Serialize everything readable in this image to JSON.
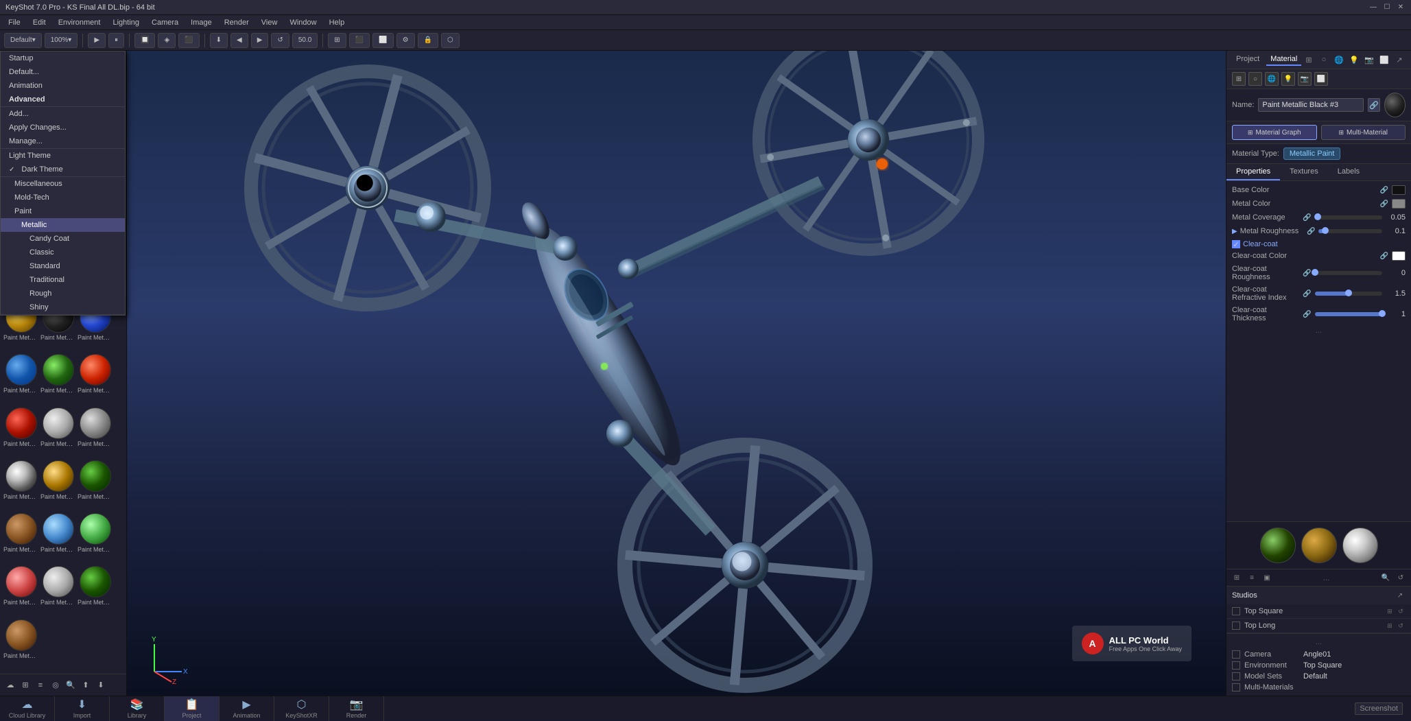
{
  "titlebar": {
    "title": "KeyShot 7.0 Pro - KS Final All DL.bip - 64 bit",
    "min": "—",
    "max": "☐",
    "close": "✕"
  },
  "menubar": {
    "items": [
      "File",
      "Edit",
      "Environment",
      "Lighting",
      "Camera",
      "Image",
      "Render",
      "View",
      "Window",
      "Help"
    ]
  },
  "toolbar": {
    "preset": "Default",
    "zoom": "100%"
  },
  "left_panel": {
    "header_icons": [
      "⬜",
      "☆"
    ],
    "sub_icons": [
      "⬜",
      "⬜",
      "↺"
    ],
    "dropdown": {
      "items_top": [
        "Startup",
        "Default...",
        "Animation",
        "Advanced"
      ],
      "items_actions": [
        "Add...",
        "Apply Changes...",
        "Manage..."
      ],
      "light_theme": "Light Theme",
      "dark_theme": "Dark Theme",
      "tree": {
        "miscellaneous": "Miscellaneous",
        "mold_tech": "Mold-Tech",
        "paint": "Paint",
        "metallic": "Metallic",
        "candy_coat": "Candy Coat",
        "classic": "Classic",
        "standard": "Standard",
        "traditional": "Traditional",
        "rough": "Rough",
        "shiny": "Shiny"
      }
    },
    "dots": "...",
    "materials": [
      {
        "label": "Paint Metal...",
        "type": "gold"
      },
      {
        "label": "Paint Metal...",
        "type": "black"
      },
      {
        "label": "Paint Metal...",
        "type": "blue"
      },
      {
        "label": "Paint Metal...",
        "type": "blue2"
      },
      {
        "label": "Paint Metal...",
        "type": "green"
      },
      {
        "label": "Paint Metal...",
        "type": "red"
      },
      {
        "label": "Paint Metal...",
        "type": "red2"
      },
      {
        "label": "Paint Metal...",
        "type": "silver"
      },
      {
        "label": "Paint Metal...",
        "type": "silver2"
      },
      {
        "label": "Paint Metal...",
        "type": "chrome"
      },
      {
        "label": "Paint Metal...",
        "type": "dgold"
      },
      {
        "label": "Paint Metal...",
        "type": "dgreen"
      },
      {
        "label": "Paint Metal...",
        "type": "brown"
      },
      {
        "label": "Paint Metal...",
        "type": "ltblue"
      },
      {
        "label": "Paint Metal...",
        "type": "ltgreen"
      },
      {
        "label": "Paint Metal...",
        "type": "ltred"
      },
      {
        "label": "Paint Metal...",
        "type": "silver"
      },
      {
        "label": "Paint Metal...",
        "type": "dgreen"
      },
      {
        "label": "Paint Metal...",
        "type": "brown"
      }
    ],
    "bottom_icons": [
      "☁",
      "⊞",
      "≡",
      "◎",
      "🔍",
      "⬆",
      "⬇"
    ]
  },
  "right_panel": {
    "project_tab": "Project",
    "material_tab": "Material",
    "rp_icons": [
      "⊞",
      "○",
      "🌐",
      "💡",
      "📷",
      "⬜"
    ],
    "mat_icons": [
      "⬜",
      "○",
      "🌐",
      "💡",
      "📷",
      "⬜",
      "↗"
    ],
    "mat_name_label": "Name:",
    "mat_name_value": "Paint Metallic Black #3",
    "material_graph_label": "Material Graph",
    "multi_material_label": "Multi-Material",
    "mat_type_label": "Material Type:",
    "mat_type_value": "Metallic Paint",
    "tabs": [
      "Properties",
      "Textures",
      "Labels"
    ],
    "properties": {
      "base_color_label": "Base Color",
      "metal_color_label": "Metal Color",
      "metal_coverage_label": "Metal Coverage",
      "metal_coverage_value": "0.05",
      "metal_roughness_label": "Metal Roughness",
      "metal_roughness_value": "0.1",
      "clearcoat_label": "Clear-coat",
      "clearcoat_color_label": "Clear-coat Color",
      "clearcoat_roughness_label": "Clear-coat Roughness",
      "clearcoat_roughness_value": "0",
      "clearcoat_refractive_label": "Clear-coat Refractive Index",
      "clearcoat_refractive_value": "1.5",
      "clearcoat_thickness_label": "Clear-coat Thickness",
      "clearcoat_thickness_value": "1"
    },
    "preview_spheres": [
      {
        "type": "forest",
        "label": ""
      },
      {
        "type": "hex",
        "label": ""
      },
      {
        "type": "chrome2",
        "label": ""
      }
    ],
    "studios": {
      "title": "Studios",
      "items": [
        {
          "label": "Top Square",
          "checked": false
        },
        {
          "label": "Top Long",
          "checked": false
        }
      ]
    },
    "scene": {
      "items": [
        {
          "label": "Camera",
          "value": "Angle01"
        },
        {
          "label": "Environment",
          "value": "Top Square"
        },
        {
          "label": "Model Sets",
          "value": "Default"
        },
        {
          "label": "Multi-Materials",
          "value": ""
        }
      ]
    }
  },
  "statusbar": {
    "buttons": [
      {
        "label": "Cloud Library",
        "icon": "☁",
        "active": false
      },
      {
        "label": "Import",
        "icon": "⬇",
        "active": false
      },
      {
        "label": "Library",
        "icon": "📚",
        "active": false
      },
      {
        "label": "Project",
        "icon": "📋",
        "active": true
      },
      {
        "label": "Animation",
        "icon": "▶",
        "active": false
      },
      {
        "label": "KeyShotXR",
        "icon": "⬡",
        "active": false
      },
      {
        "label": "Render",
        "icon": "📷",
        "active": false
      }
    ],
    "screenshot": "Screenshot"
  },
  "viewport": {
    "watermark_title": "ALL PC World",
    "watermark_sub": "Free Apps One Click Away"
  }
}
